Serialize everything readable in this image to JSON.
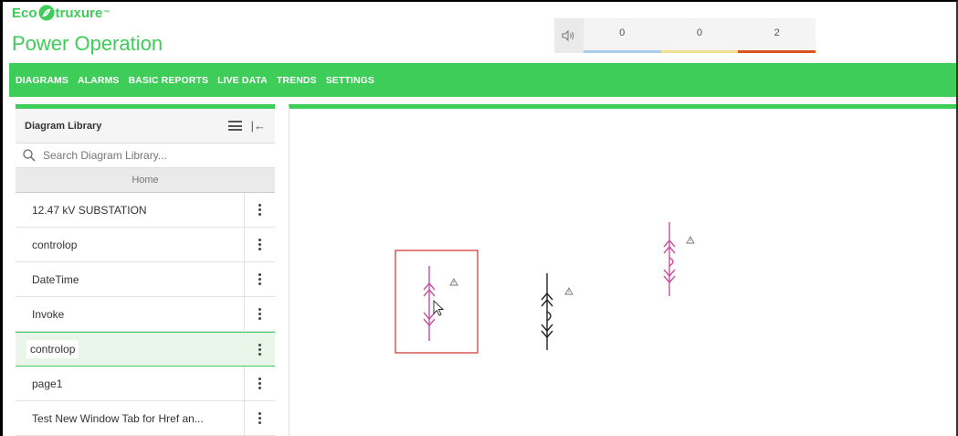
{
  "header": {
    "logo": {
      "prefix": "Eco",
      "suffix": "truxure"
    },
    "app_title": "Power Operation"
  },
  "alarm_widget": {
    "sound_icon": "speaker-icon",
    "counts": [
      {
        "value": "0",
        "color": "#a9cdea"
      },
      {
        "value": "0",
        "color": "#f0df90"
      },
      {
        "value": "2",
        "color": "#d9541e"
      }
    ]
  },
  "nav": {
    "items": [
      "DIAGRAMS",
      "ALARMS",
      "BASIC REPORTS",
      "LIVE DATA",
      "TRENDS",
      "SETTINGS"
    ]
  },
  "sidebar": {
    "title": "Diagram Library",
    "search_placeholder": "Search Diagram Library...",
    "breadcrumb": "Home",
    "items": [
      {
        "label": "12.47 kV SUBSTATION"
      },
      {
        "label": "controlop"
      },
      {
        "label": "DateTime"
      },
      {
        "label": "Invoke"
      },
      {
        "label": "controlop"
      },
      {
        "label": "page1"
      },
      {
        "label": "Test New Window Tab for Href an..."
      }
    ]
  },
  "colors": {
    "brand_green": "#3dcd58",
    "symbol_magenta": "#c8509e",
    "symbol_black": "#222222",
    "selection_red": "#d32f2f"
  }
}
